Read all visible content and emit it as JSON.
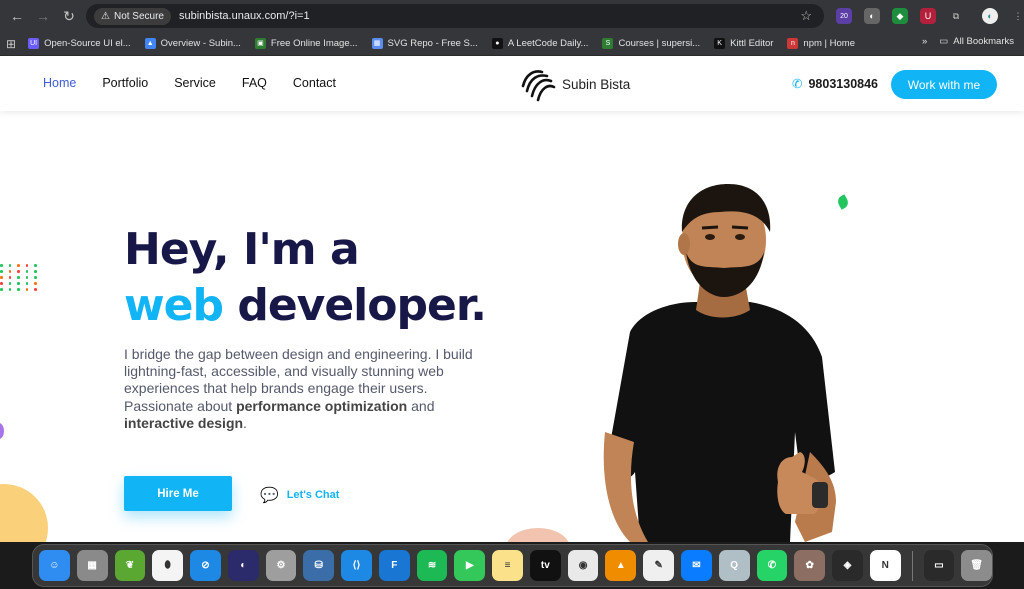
{
  "browser": {
    "security_label": "Not Secure",
    "url": "subinbista.unaux.com/?i=1",
    "extension_badge": "20",
    "bookmarks": [
      {
        "label": "Open-Source UI el...",
        "color": "#6b5cff",
        "icon_text": "UI"
      },
      {
        "label": "Overview - Subin...",
        "color": "#4285f4",
        "icon_text": "▲"
      },
      {
        "label": "Free Online Image...",
        "color": "#2e7d32",
        "icon_text": "▣"
      },
      {
        "label": "SVG Repo - Free S...",
        "color": "#5a8dee",
        "icon_text": "▦"
      },
      {
        "label": "A LeetCode Daily...",
        "color": "#111111",
        "icon_text": "●"
      },
      {
        "label": "Courses | supersi...",
        "color": "#2e7d32",
        "icon_text": "S"
      },
      {
        "label": "Kittl Editor",
        "color": "#111111",
        "icon_text": "K"
      },
      {
        "label": "npm | Home",
        "color": "#cb3837",
        "icon_text": "n"
      }
    ],
    "all_bookmarks_label": "All Bookmarks"
  },
  "site": {
    "nav": [
      "Home",
      "Portfolio",
      "Service",
      "FAQ",
      "Contact"
    ],
    "logo_text": "Subin Bista",
    "phone": "9803130846",
    "work_button": "Work with me",
    "hero": {
      "line1": "Hey, I'm a",
      "accent": "web",
      "line2_rest": " developer.",
      "para_intro": "I bridge the gap between design and engineering. I build lightning-fast, accessible, and visually stunning web experiences that help brands engage their users. Passionate about ",
      "para_bold1": "performance optimization",
      "para_mid": " and ",
      "para_bold2": "interactive design",
      "para_end": "."
    },
    "hire_button": "Hire Me",
    "chat_link": "Let's Chat"
  },
  "dock": {
    "apps": [
      {
        "name": "finder",
        "color": "#2f8cf0",
        "label": "☺"
      },
      {
        "name": "launchpad",
        "color": "#8a8a8a",
        "label": "▦"
      },
      {
        "name": "spring-tool",
        "color": "#5aa832",
        "label": "❦"
      },
      {
        "name": "mongodb-compass",
        "color": "#f4f4f4",
        "label": "⬮"
      },
      {
        "name": "safari",
        "color": "#1e88e5",
        "label": "⊘"
      },
      {
        "name": "eclipse",
        "color": "#2b2b6b",
        "label": "◐"
      },
      {
        "name": "system-settings",
        "color": "#9e9e9e",
        "label": "⚙"
      },
      {
        "name": "mysql-workbench",
        "color": "#3b6ea8",
        "label": "⛁"
      },
      {
        "name": "vscode",
        "color": "#1e88e5",
        "label": "⟨⟩"
      },
      {
        "name": "framer",
        "color": "#1976d2",
        "label": "F"
      },
      {
        "name": "spotify",
        "color": "#1db954",
        "label": "≋"
      },
      {
        "name": "facetime",
        "color": "#34c759",
        "label": "▶"
      },
      {
        "name": "notes",
        "color": "#fbe28a",
        "label": "≡"
      },
      {
        "name": "apple-tv",
        "color": "#111111",
        "label": "tv"
      },
      {
        "name": "chrome",
        "color": "#e9e9e9",
        "label": "◉"
      },
      {
        "name": "vlc",
        "color": "#f08c00",
        "label": "▲"
      },
      {
        "name": "textedit",
        "color": "#efefef",
        "label": "✎"
      },
      {
        "name": "messenger",
        "color": "#0a7cff",
        "label": "✉"
      },
      {
        "name": "quicktime",
        "color": "#b0bec5",
        "label": "Q"
      },
      {
        "name": "whatsapp",
        "color": "#25d366",
        "label": "✆"
      },
      {
        "name": "gimp",
        "color": "#8d6e63",
        "label": "✿"
      },
      {
        "name": "davinci-resolve",
        "color": "#2a2a2a",
        "label": "◈"
      },
      {
        "name": "notion",
        "color": "#ffffff",
        "label": "N"
      }
    ],
    "extra": [
      {
        "name": "terminal-window",
        "color": "#2a2a2a",
        "label": "▭"
      },
      {
        "name": "trash",
        "color": "#8c8c8c",
        "label": "🗑"
      }
    ]
  },
  "colors": {
    "accent": "#11b4f5",
    "heading": "#181848",
    "nav_active": "#3e5bd8"
  }
}
